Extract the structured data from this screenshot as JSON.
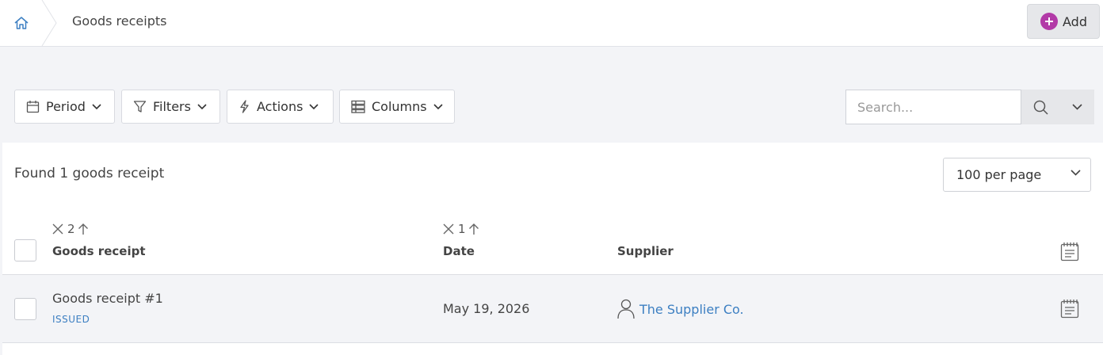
{
  "breadcrumb": {
    "current": "Goods receipts"
  },
  "header": {
    "add_label": "Add"
  },
  "toolbar": {
    "period_label": "Period",
    "filters_label": "Filters",
    "actions_label": "Actions",
    "columns_label": "Columns",
    "search_placeholder": "Search...",
    "search_value": ""
  },
  "summary": {
    "found_text": "Found 1 goods receipt"
  },
  "pagination": {
    "per_page": "100 per page"
  },
  "table": {
    "columns": [
      {
        "label": "Goods receipt",
        "sort_order": "2",
        "sort_dir": "asc"
      },
      {
        "label": "Date",
        "sort_order": "1",
        "sort_dir": "asc"
      },
      {
        "label": "Supplier"
      }
    ],
    "rows": [
      {
        "title": "Goods receipt #1",
        "status": "ISSUED",
        "date": "May 19, 2026",
        "supplier": "The Supplier Co."
      }
    ]
  },
  "colors": {
    "accent_link": "#3c7fc2",
    "add_icon": "#b23aa7",
    "toolbar_bg": "#f3f4f7"
  },
  "icons": {
    "home": "home-icon",
    "add": "plus-circle-icon",
    "period": "calendar-icon",
    "filters": "funnel-icon",
    "actions": "lightning-icon",
    "columns": "columns-icon",
    "search": "search-icon",
    "supplier": "person-icon",
    "notes": "notepad-icon"
  }
}
